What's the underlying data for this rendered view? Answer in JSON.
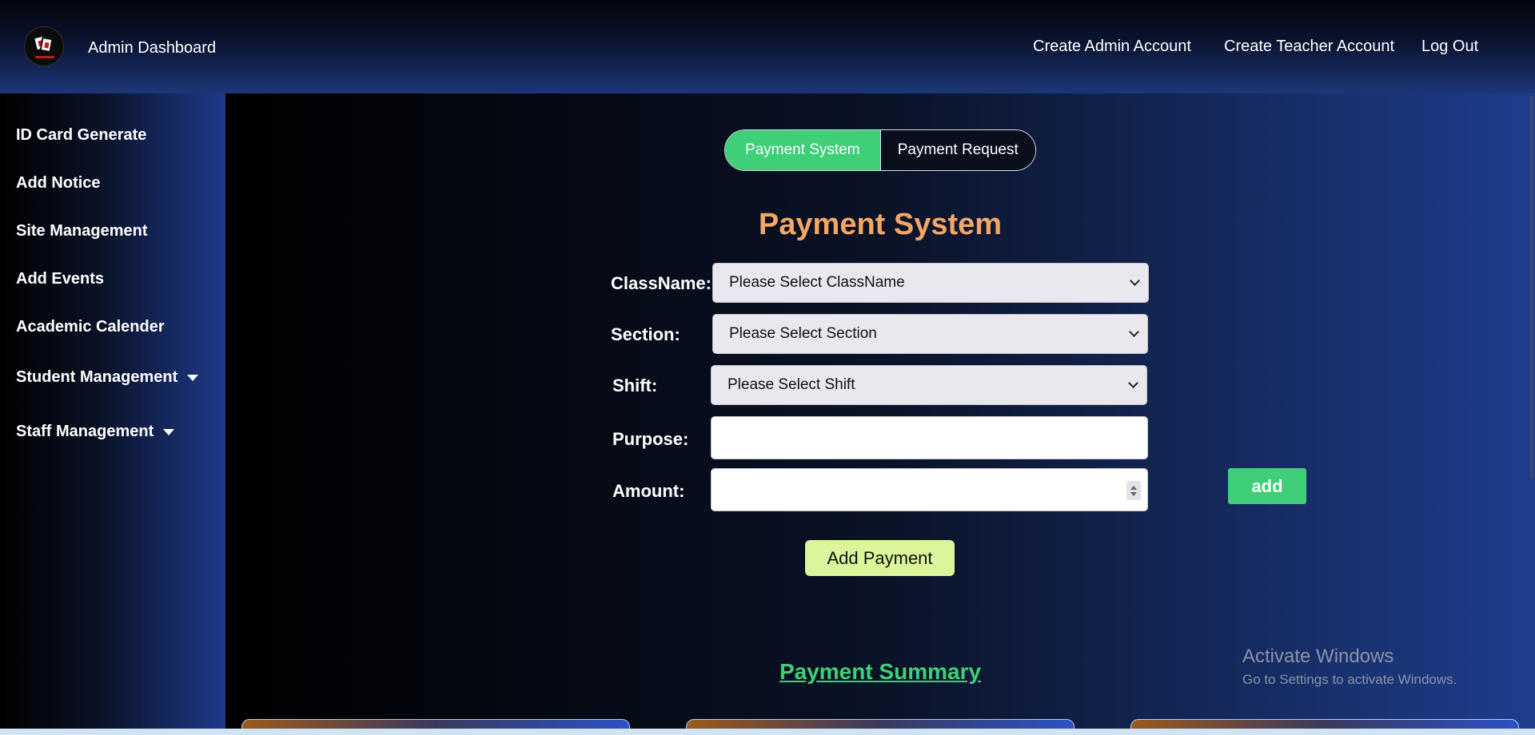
{
  "header": {
    "app_title": "Admin Dashboard",
    "nav": [
      "Create Admin Account",
      "Create Teacher Account",
      "Log Out"
    ]
  },
  "sidebar": {
    "items": [
      {
        "label": "ID Card Generate"
      },
      {
        "label": "Add Notice"
      },
      {
        "label": "Site Management"
      },
      {
        "label": "Add Events"
      },
      {
        "label": "Academic Calender"
      },
      {
        "label": "Student Management",
        "dropdown": true
      },
      {
        "label": "Staff Management",
        "dropdown": true
      }
    ]
  },
  "tabs": {
    "active": "Payment System",
    "inactive": "Payment Request"
  },
  "form": {
    "title": "Payment System",
    "classname_label": "ClassName:",
    "classname_value": "Please Select ClassName",
    "section_label": "Section:",
    "section_value": "Please Select Section",
    "shift_label": "Shift:",
    "shift_value": "Please Select Shift",
    "purpose_label": "Purpose:",
    "purpose_value": "",
    "amount_label": "Amount:",
    "amount_value": "",
    "add_label": "add",
    "submit_label": "Add Payment"
  },
  "summary": {
    "title": "Payment Summary"
  },
  "watermark": {
    "line1": "Activate Windows",
    "line2": "Go to Settings to activate Windows."
  },
  "colors": {
    "accent_green": "#3ecf78",
    "title_orange": "#f5a662",
    "submit_lime": "#dbf59a"
  }
}
